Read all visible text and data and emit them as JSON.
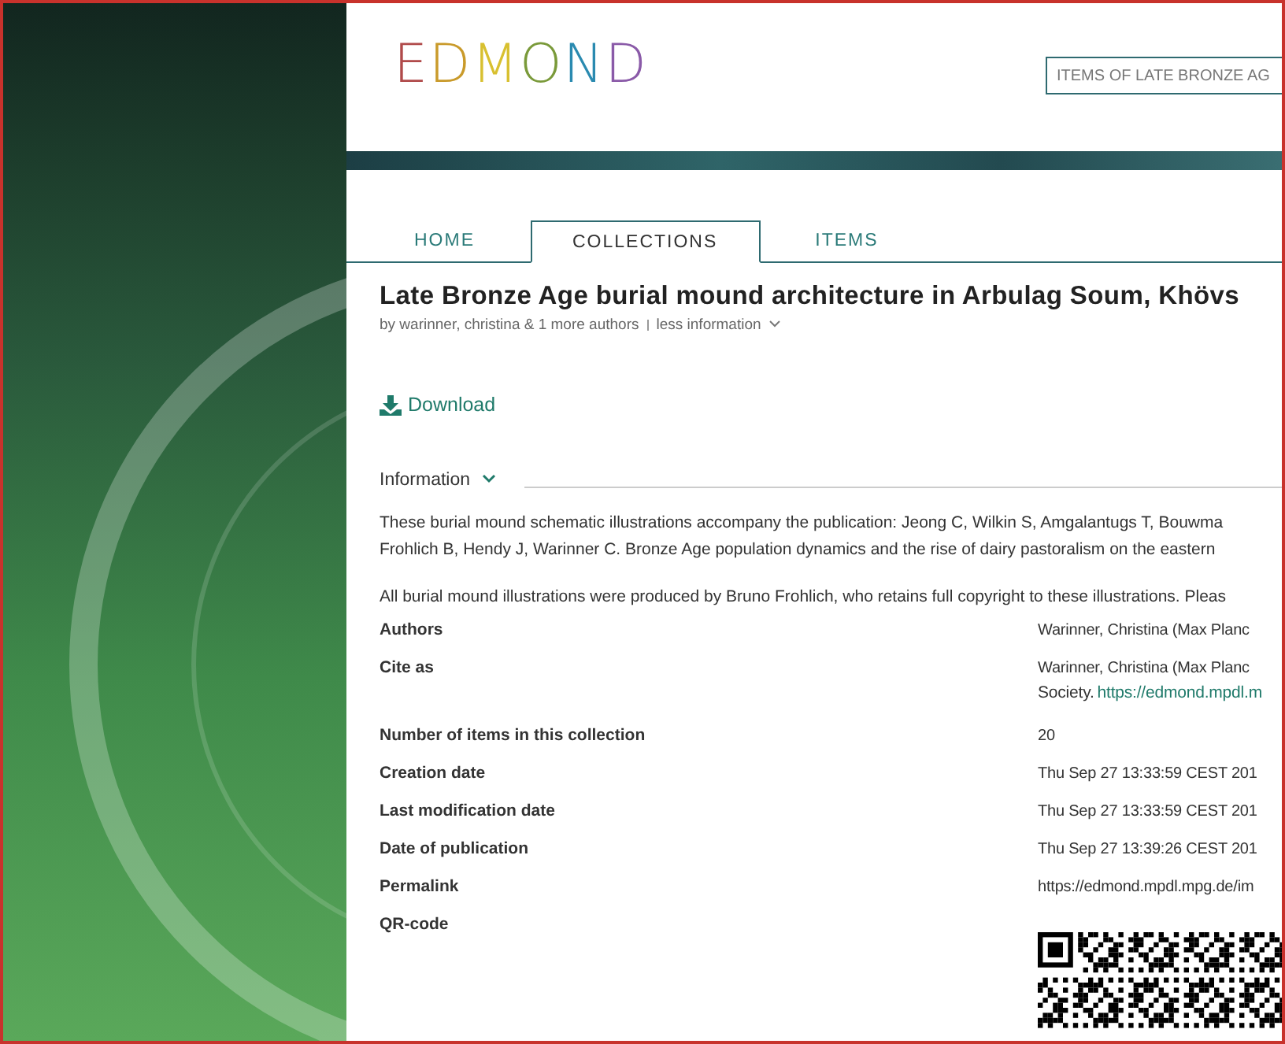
{
  "logo": "EDMOND",
  "search": {
    "placeholder": "ITEMS OF LATE BRONZE AG"
  },
  "tabs": [
    {
      "label": "HOME",
      "selected": false
    },
    {
      "label": "COLLECTIONS",
      "selected": true
    },
    {
      "label": "ITEMS",
      "selected": false
    }
  ],
  "collection": {
    "title": "Late Bronze Age burial mound architecture in Arbulag Soum, Khövs",
    "byline": "by warinner, christina & 1 more authors",
    "less_information": "less information"
  },
  "download": "Download",
  "information": {
    "label": "Information",
    "expanded": true,
    "description": [
      "These burial mound schematic illustrations accompany the publication: Jeong C, Wilkin S, Amgalantugs T, Bouwma",
      "Frohlich B, Hendy J, Warinner C. Bronze Age population dynamics and the rise of dairy pastoralism on the eastern"
    ],
    "note": "All burial mound illustrations were produced by Bruno Frohlich, who retains full copyright to these illustrations. Pleas",
    "fields": [
      {
        "label": "Authors",
        "kind": "text",
        "lines": [
          "Warinner, Christina (Max Planc"
        ]
      },
      {
        "label": "Cite as",
        "kind": "cite",
        "lines": [
          "Warinner, Christina (Max Planc",
          "Society."
        ],
        "link": "https://edmond.mpdl.m"
      },
      {
        "label": "Number of items in this collection",
        "kind": "text",
        "lines": [
          "20"
        ]
      },
      {
        "label": "Creation date",
        "kind": "text",
        "lines": [
          "Thu Sep 27 13:33:59 CEST 201"
        ]
      },
      {
        "label": "Last modification date",
        "kind": "text",
        "lines": [
          "Thu Sep 27 13:33:59 CEST 201"
        ]
      },
      {
        "label": "Date of publication",
        "kind": "text",
        "lines": [
          "Thu Sep 27 13:39:26 CEST 201"
        ]
      },
      {
        "label": "Permalink",
        "kind": "text",
        "lines": [
          "https://edmond.mpdl.mpg.de/im"
        ]
      },
      {
        "label": "QR-code",
        "kind": "qr"
      }
    ]
  }
}
